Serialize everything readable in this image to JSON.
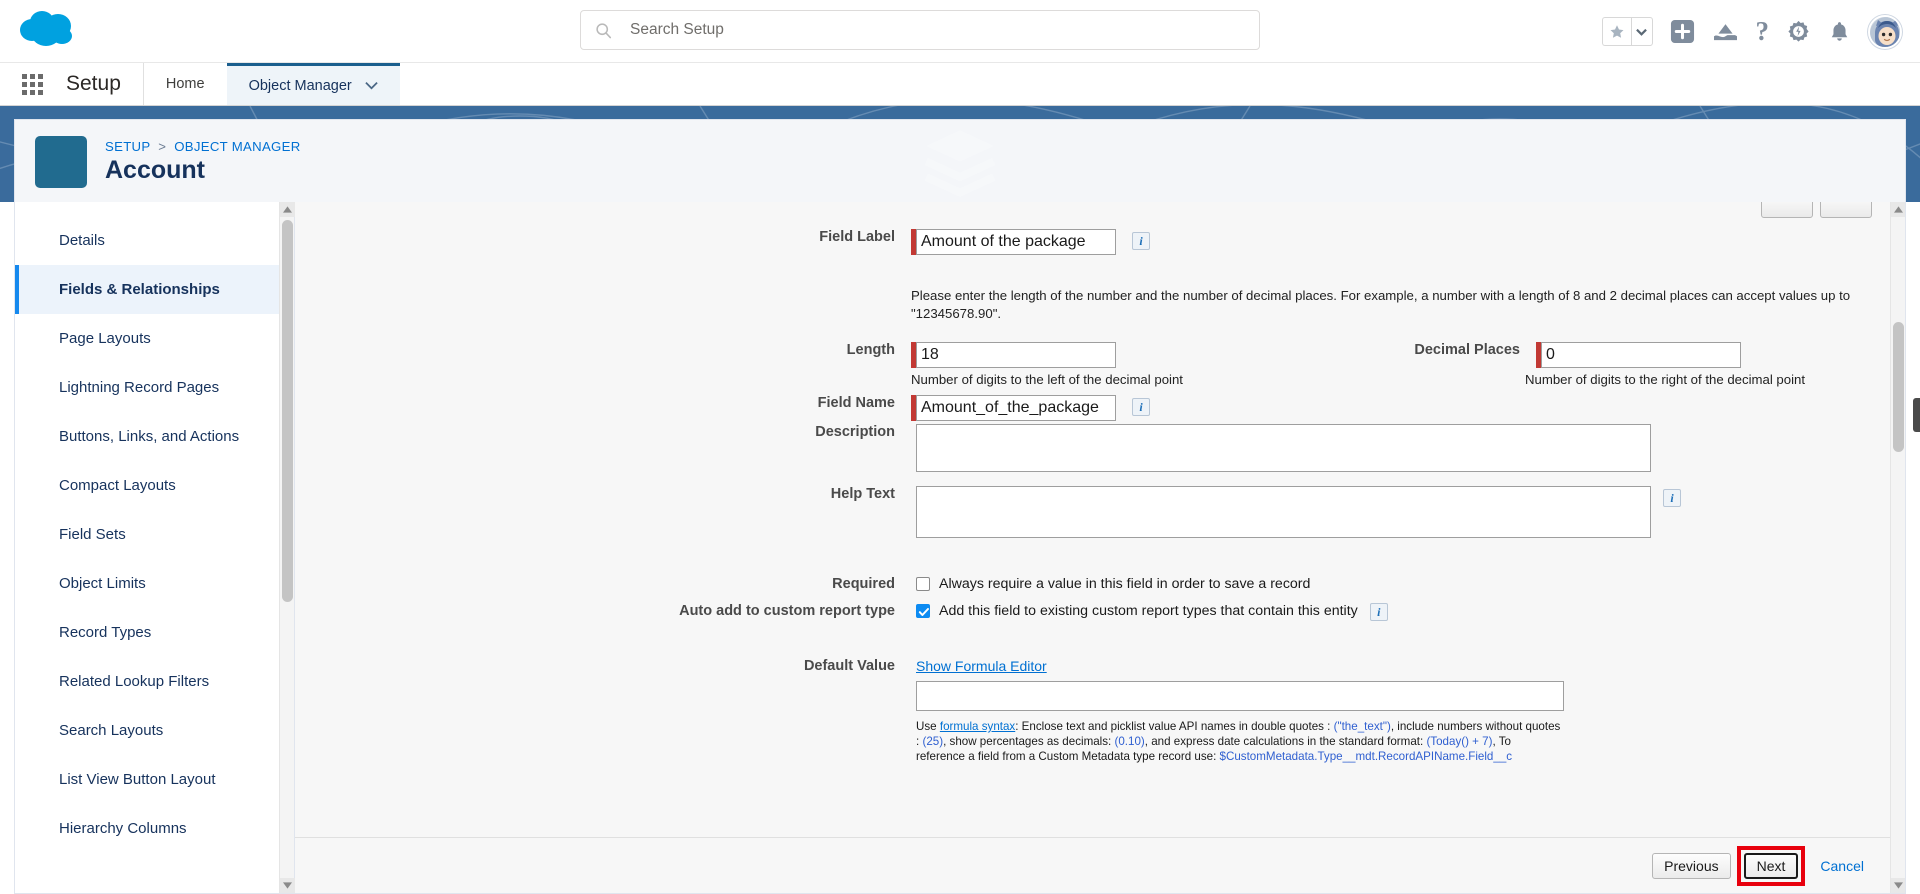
{
  "header": {
    "logo_name": "salesforce-cloud-logo",
    "search": {
      "placeholder": "Search Setup",
      "value": ""
    },
    "icons": {
      "favorites": "star-icon",
      "favorites_caret": "chevron-down-icon",
      "add": "plus-icon",
      "learning": "trailhead-icon",
      "help": "?",
      "setup_gear": "gear-icon",
      "notifications": "bell-icon",
      "avatar": "user-avatar"
    }
  },
  "setup_nav": {
    "app_launcher": "app-launcher-icon",
    "title": "Setup",
    "tabs": [
      {
        "label": "Home",
        "active": false,
        "has_caret": false
      },
      {
        "label": "Object Manager",
        "active": true,
        "has_caret": true
      }
    ]
  },
  "record_header": {
    "breadcrumb": {
      "parent": "SETUP",
      "separator": ">",
      "current": "OBJECT MANAGER"
    },
    "title": "Account",
    "icon": "layers-icon"
  },
  "sidebar": {
    "items": [
      {
        "label": "Details",
        "active": false
      },
      {
        "label": "Fields & Relationships",
        "active": true
      },
      {
        "label": "Page Layouts",
        "active": false
      },
      {
        "label": "Lightning Record Pages",
        "active": false
      },
      {
        "label": "Buttons, Links, and Actions",
        "active": false
      },
      {
        "label": "Compact Layouts",
        "active": false
      },
      {
        "label": "Field Sets",
        "active": false
      },
      {
        "label": "Object Limits",
        "active": false
      },
      {
        "label": "Record Types",
        "active": false
      },
      {
        "label": "Related Lookup Filters",
        "active": false
      },
      {
        "label": "Search Layouts",
        "active": false
      },
      {
        "label": "List View Button Layout",
        "active": false
      },
      {
        "label": "Hierarchy Columns",
        "active": false
      }
    ]
  },
  "form": {
    "field_label": {
      "label": "Field Label",
      "value": "Amount of the package",
      "required": true
    },
    "intro_note": "Please enter the length of the number and the number of decimal places. For example, a number with a length of 8 and 2 decimal places can accept values up to \"12345678.90\".",
    "length": {
      "label": "Length",
      "value": "18",
      "required": true,
      "help": "Number of digits to the left of the decimal point"
    },
    "decimal_places": {
      "label": "Decimal Places",
      "value": "0",
      "required": true,
      "help": "Number of digits to the right of the decimal point"
    },
    "field_name": {
      "label": "Field Name",
      "value": "Amount_of_the_package",
      "required": true
    },
    "description": {
      "label": "Description",
      "value": ""
    },
    "help_text": {
      "label": "Help Text",
      "value": ""
    },
    "required_row": {
      "label": "Required",
      "checkbox_text": "Always require a value in this field in order to save a record",
      "checked": false
    },
    "auto_add_row": {
      "label": "Auto add to custom report type",
      "checkbox_text": "Add this field to existing custom report types that contain this entity",
      "checked": true
    },
    "default_value": {
      "label": "Default Value",
      "formula_editor_link": "Show Formula Editor",
      "value": "",
      "note_line1_a": "Use ",
      "note_link": "formula syntax",
      "note_line1_b": ": Enclose text and picklist value API names in double quotes : ",
      "code1": "(\"the_text\")",
      "note_line1_c": ", include numbers without quotes",
      "note_line2_a": ": ",
      "code2": "(25)",
      "note_line2_b": ", show percentages as decimals: ",
      "code3": "(0.10)",
      "note_line2_c": ", and express date calculations in the standard format: ",
      "code4": "(Today() + 7)",
      "note_line2_d": ", To",
      "note_line3_a": "reference a field from a Custom Metadata type record use: ",
      "code5": "$CustomMetadata.Type__mdt.RecordAPIName.Field__c"
    }
  },
  "actions": {
    "previous": "Previous",
    "next": "Next",
    "cancel": "Cancel",
    "highlight_color": "#e8000d"
  },
  "colors": {
    "banner": "#3a6b9c",
    "link": "#0070d2",
    "active_sidebar": "#ecf3fb",
    "required_marker": "#c23934",
    "checkbox_checked": "#0d8bf2"
  }
}
